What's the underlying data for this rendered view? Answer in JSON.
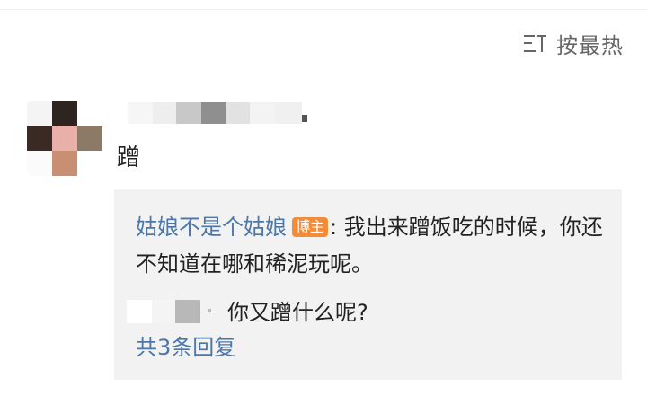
{
  "sort": {
    "label": "按最热",
    "icon": "sort-lines-icon"
  },
  "comment": {
    "text": "蹭",
    "avatar_icon": "pixelated-avatar",
    "username_icon": "blurred-username"
  },
  "replies": [
    {
      "author": "姑娘不是个姑娘",
      "badge": "博主",
      "separator": ":",
      "text": "我出来蹭饭吃的时候，你还不知道在哪和稀泥玩呢。"
    },
    {
      "author_icon": "blurred-username",
      "text": "你又蹭什么呢?"
    }
  ],
  "more_replies": "共3条回复",
  "colors": {
    "link": "#4a76a8",
    "badge": "#f58a37",
    "reply_bg": "#f2f2f2"
  }
}
